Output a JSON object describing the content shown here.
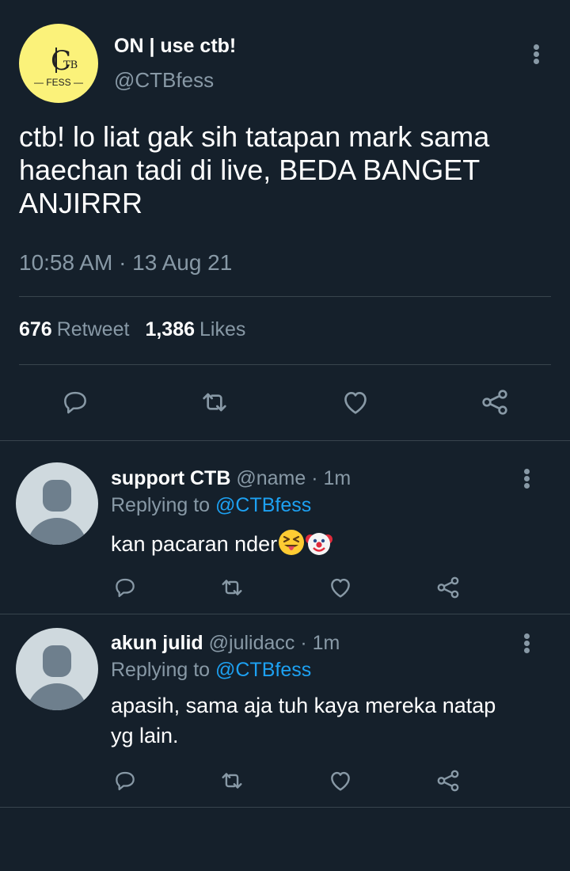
{
  "tweet": {
    "author_name": "ON  |  use ctb!",
    "author_handle": "@CTBfess",
    "avatar": {
      "logo_initials": "C",
      "logo_superscript": "TB",
      "logo_text": "— FESS —",
      "background": "#fbf27a"
    },
    "text": "ctb! lo liat gak sih tatapan mark sama haechan tadi di live, BEDA BANGET ANJIRRR",
    "timestamp": "10:58 AM · 13 Aug 21",
    "retweets_count": "676",
    "retweets_label": "Retweet",
    "likes_count": "1,386",
    "likes_label": "Likes",
    "actions": [
      "reply-icon",
      "retweet-icon",
      "like-icon",
      "share-icon"
    ]
  },
  "replies": [
    {
      "name": "support CTB",
      "handle": "@name",
      "time": "· 1m",
      "replying_label": "Replying to",
      "replying_to": "@CTBfess",
      "text": "kan pacaran nder",
      "emojis": [
        "squinting-tongue-emoji",
        "clown-emoji"
      ]
    },
    {
      "name": "akun julid",
      "handle": "@julidacc",
      "time": "· 1m",
      "replying_label": "Replying to",
      "replying_to": "@CTBfess",
      "text": "apasih, sama aja tuh kaya mereka natap yg lain."
    }
  ],
  "colors": {
    "background": "#15202b",
    "divider": "#38444d",
    "muted": "#8899a6",
    "link": "#1da1f2",
    "text": "#ffffff"
  }
}
